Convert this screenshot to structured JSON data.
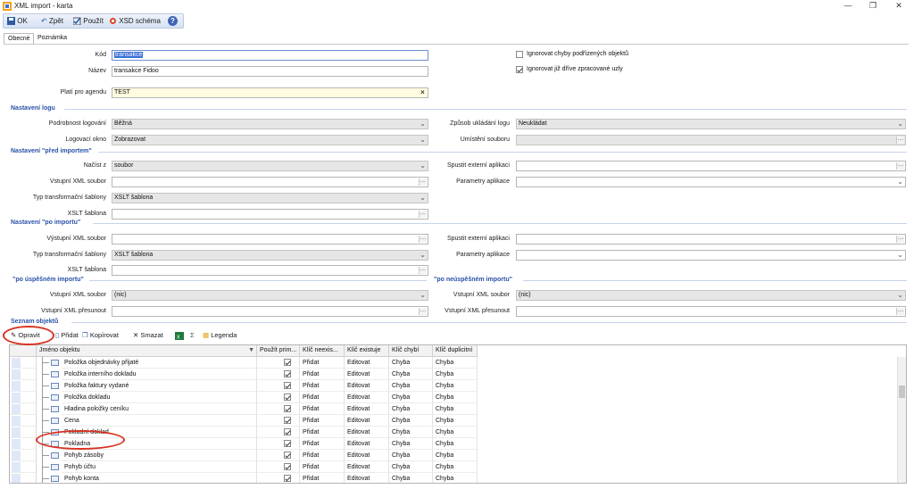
{
  "window": {
    "title": "XML import - karta",
    "min": "—",
    "restore": "❐",
    "close": "✕"
  },
  "toolbar": {
    "ok": "OK",
    "back": "Zpět",
    "apply": "Použít",
    "xsd": "XSD schéma",
    "help": "?"
  },
  "tabs": [
    "Obecné",
    "Poznámka"
  ],
  "form": {
    "kod_label": "Kód",
    "kod_value": "transakce",
    "nazev_label": "Název",
    "nazev_value": "transakce Fidoo",
    "agenda_label": "Platí pro agendu",
    "agenda_value": "TEST",
    "chk1_label": "Ignorovat chyby podřízených objektů",
    "chk1": false,
    "chk2_label": "Ignorovat již dříve zpracované uzly",
    "chk2": true
  },
  "log": {
    "section": "Nastavení logu",
    "detail_label": "Podrobnost logování",
    "detail_value": "Běžná",
    "window_label": "Logovací okno",
    "window_value": "Zobrazovat",
    "save_label": "Způsob ukládání logu",
    "save_value": "Neukládat",
    "location_label": "Umístění souboru",
    "location_value": ""
  },
  "pre": {
    "section": "Nastavení \"před importem\"",
    "load_label": "Načíst z",
    "load_value": "soubor",
    "input_label": "Vstupní XML soubor",
    "input_value": "",
    "type_label": "Typ transformační šablony",
    "type_value": "XSLT šablona",
    "xslt_label": "XSLT šablona",
    "xslt_value": "",
    "ext_label": "Spustit externí aplikaci",
    "ext_value": "",
    "params_label": "Parametry aplikace",
    "params_value": ""
  },
  "post": {
    "section": "Nastavení \"po importu\"",
    "output_label": "Výstupní XML soubor",
    "output_value": "",
    "type_label": "Typ transformační šablony",
    "type_value": "XSLT šablona",
    "xslt_label": "XSLT šablona",
    "xslt_value": "",
    "ext_label": "Spustit externí aplikaci",
    "ext_value": "",
    "params_label": "Parametry aplikace",
    "params_value": ""
  },
  "success": {
    "section": "\"po úspěšném importu\"",
    "input_label": "Vstupní XML soubor",
    "input_value": "(nic)",
    "move_label": "Vstupní XML přesunout",
    "move_value": ""
  },
  "failure": {
    "section": "\"po neúspěšném importu\"",
    "input_label": "Vstupní XML soubor",
    "input_value": "(nic)",
    "move_label": "Vstupní XML přesunout",
    "move_value": ""
  },
  "objects": {
    "section": "Seznam objektů",
    "toolbar": {
      "edit": "Opravit",
      "add": "Přidat",
      "copy": "Kopírovat",
      "delete": "Smazat",
      "sum": "Σ",
      "legend": "Legenda"
    },
    "columns": [
      "Jméno objektu",
      "Použít prim...",
      "Klíč neexis...",
      "Klíč existuje",
      "Klíč chybí",
      "Klíč duplicitní"
    ],
    "rows": [
      {
        "name": "Položka objednávky přijaté",
        "k1": "Přidat",
        "k2": "Editovat",
        "k3": "Chyba",
        "k4": "Chyba"
      },
      {
        "name": "Položka interního dokladu",
        "k1": "Přidat",
        "k2": "Editovat",
        "k3": "Chyba",
        "k4": "Chyba"
      },
      {
        "name": "Položka faktury vydané",
        "k1": "Přidat",
        "k2": "Editovat",
        "k3": "Chyba",
        "k4": "Chyba"
      },
      {
        "name": "Položka dokladu",
        "k1": "Přidat",
        "k2": "Editovat",
        "k3": "Chyba",
        "k4": "Chyba"
      },
      {
        "name": "Hladina položky ceníku",
        "k1": "Přidat",
        "k2": "Editovat",
        "k3": "Chyba",
        "k4": "Chyba"
      },
      {
        "name": "Cena",
        "k1": "Přidat",
        "k2": "Editovat",
        "k3": "Chyba",
        "k4": "Chyba"
      },
      {
        "name": "Pokladní doklad",
        "k1": "Přidat",
        "k2": "Editovat",
        "k3": "Chyba",
        "k4": "Chyba"
      },
      {
        "name": "Pokladna",
        "k1": "Přidat",
        "k2": "Editovat",
        "k3": "Chyba",
        "k4": "Chyba"
      },
      {
        "name": "Pohyb zásoby",
        "k1": "Přidat",
        "k2": "Editovat",
        "k3": "Chyba",
        "k4": "Chyba"
      },
      {
        "name": "Pohyb účtu",
        "k1": "Přidat",
        "k2": "Editovat",
        "k3": "Chyba",
        "k4": "Chyba"
      },
      {
        "name": "Pohyb konta",
        "k1": "Přidat",
        "k2": "Editovat",
        "k3": "Chyba",
        "k4": "Chyba"
      }
    ]
  },
  "colors": {
    "section": "#2a52a8",
    "highlight": "#d8321f",
    "selected": "#3a6fd6"
  }
}
